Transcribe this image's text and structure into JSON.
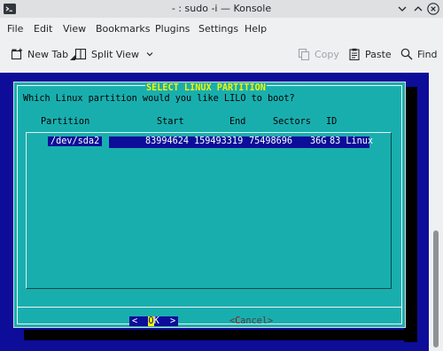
{
  "window": {
    "title": "- : sudo -i — Konsole",
    "icons": [
      "konsole-app-icon",
      "chevron-down-icon",
      "chevron-up-icon",
      "close-icon"
    ]
  },
  "menu": [
    "File",
    "Edit",
    "View",
    "Bookmarks",
    "Plugins",
    "Settings",
    "Help"
  ],
  "toolbar": {
    "new_tab": "New Tab",
    "split_view": "Split View",
    "copy": "Copy",
    "paste": "Paste",
    "find": "Find"
  },
  "dialog": {
    "title": "SELECT LINUX PARTITION",
    "question": "Which Linux partition would you like LILO to boot?",
    "columns": [
      "Partition",
      "Start",
      "End",
      "Sectors",
      "ID"
    ],
    "rows": [
      {
        "partition": "/dev/sda2",
        "start": "83994624",
        "end": "159493319",
        "sectors": "75498696",
        "size": "36G",
        "id": "83 Linux"
      }
    ],
    "ok_left": "<",
    "ok_hotkey": "O",
    "ok_rest": "K",
    "ok_right": ">",
    "cancel_left": "<",
    "cancel_hotkey": "C",
    "cancel_rest": "ancel",
    "cancel_right": ">"
  },
  "colors": {
    "terminal_bg": "#0d0d9a",
    "dialog_bg": "#19aeae",
    "title_fg": "#f4f400",
    "chrome_bg": "#eff0f1"
  }
}
